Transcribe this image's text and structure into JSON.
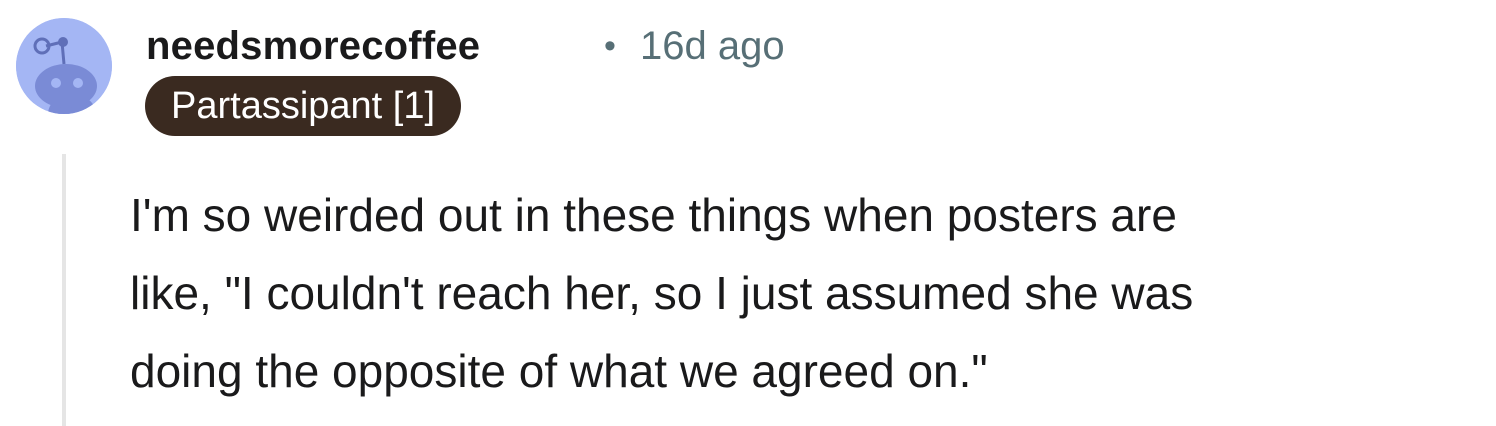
{
  "comment": {
    "username": "needsmorecoffee",
    "separator": "•",
    "timestamp": "16d ago",
    "flair": "Partassipant [1]",
    "body_lines": [
      "I'm so weirded out in these things when posters are",
      "like, \"I couldn't reach her, so I just assumed she was",
      "doing the opposite of what we agreed on.\""
    ]
  },
  "avatar": {
    "icon": "reddit-snoo-icon",
    "background_color": "#a4b6f4"
  },
  "colors": {
    "flair_background": "#3a2a20",
    "meta_text": "#576f76"
  }
}
